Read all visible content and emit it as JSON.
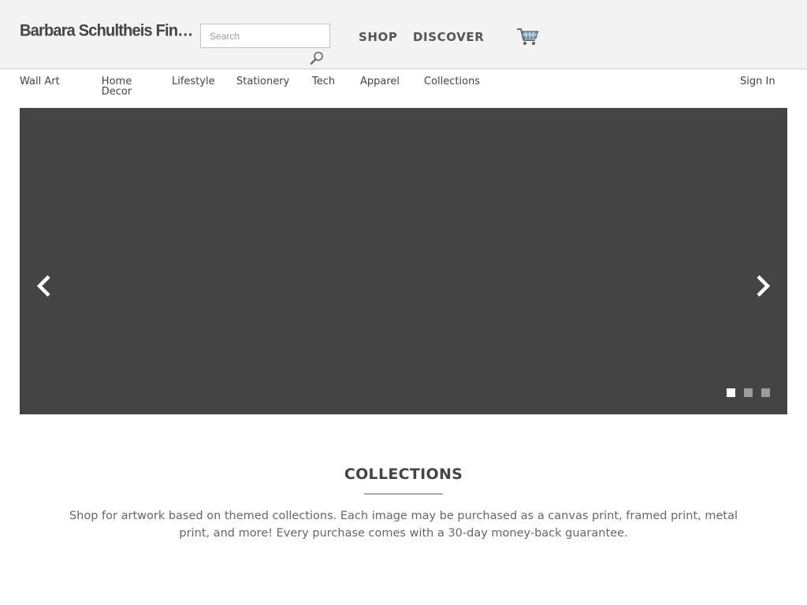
{
  "header": {
    "site_title": "Barbara Schultheis Fine Art Photography",
    "search": {
      "placeholder": "Search",
      "value": ""
    },
    "nav": {
      "shop": "SHOP",
      "discover": "DISCOVER"
    },
    "icons": {
      "search": "magnifier-icon",
      "cart": "shopping-cart-icon"
    }
  },
  "categories": {
    "items": [
      {
        "label": "Wall Art"
      },
      {
        "label": "Home Decor"
      },
      {
        "label": "Lifestyle"
      },
      {
        "label": "Stationery"
      },
      {
        "label": "Tech"
      },
      {
        "label": "Apparel"
      },
      {
        "label": "Collections"
      }
    ],
    "sign_in": "Sign In"
  },
  "slider": {
    "background_color": "#444444",
    "icons": {
      "prev": "chevron-left-icon",
      "next": "chevron-right-icon"
    },
    "slides_count": 3,
    "active_slide": 1
  },
  "main": {
    "section_title": "COLLECTIONS",
    "description": "Shop for artwork based on themed collections. Each image may be purchased as a canvas print, framed print, metal print, and more! Every purchase comes with a 30-day money-back guarantee."
  }
}
